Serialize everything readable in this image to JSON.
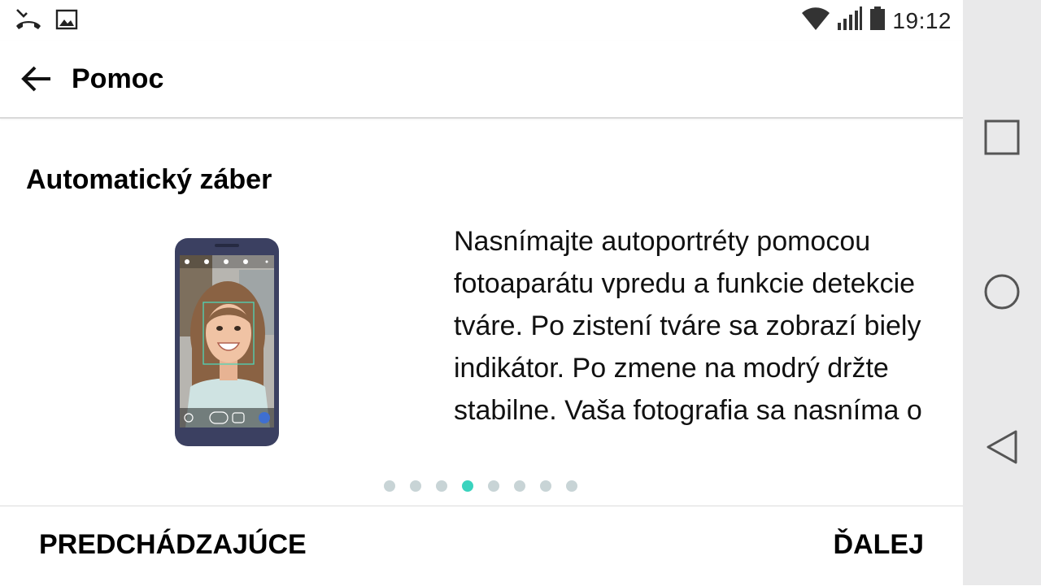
{
  "status_bar": {
    "time": "19:12",
    "left_icons": [
      "missed-call-icon",
      "image-icon"
    ],
    "right_icons": [
      "wifi-icon",
      "signal-icon",
      "battery-icon"
    ]
  },
  "header": {
    "title": "Pomoc",
    "back_icon": "arrow-back-icon"
  },
  "content": {
    "section_title": "Automatický záber",
    "description": "Nasnímajte autoportréty pomocou fotoaparátu vpredu a funkcie detekcie tváre. Po zistení tváre sa zobrazí biely indikátor. Po zmene na modrý držte stabilne. Vaša fotografia sa nasníma o",
    "illustration_icon": "phone-selfie-illustration"
  },
  "pager": {
    "total": 8,
    "current": 4,
    "active_color": "#3ad3be",
    "inactive_color": "#c8d4d6"
  },
  "footer": {
    "prev_label": "PREDCHÁDZAJÚCE",
    "next_label": "ĎALEJ"
  },
  "navigation_bar": {
    "buttons": [
      "recents-square-icon",
      "home-circle-icon",
      "back-triangle-icon"
    ]
  }
}
